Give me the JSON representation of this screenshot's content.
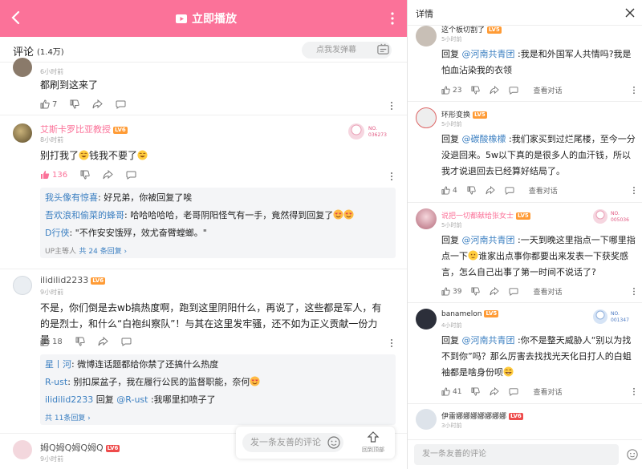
{
  "topbar": {
    "play_label": "立即播放"
  },
  "comments_header": {
    "title": "评论",
    "count": "(1.4万)",
    "danmu_placeholder": "点我发弹幕"
  },
  "left_comments": [
    {
      "time": "6小时前",
      "text": "都刷到这来了",
      "likes": "7"
    },
    {
      "user": "艾斯卡罗比亚教授",
      "level": "LV6",
      "time": "8小时前",
      "text": "别打我了",
      "text2": "钱我不要了",
      "likes": "136",
      "badge_no": "NO.\n036273",
      "replies": [
        {
          "user": "我头像有惊喜",
          "text": ": 好兄弟，你被回复了唉"
        },
        {
          "user": "吾欢浪和偷菜的蜂哥",
          "text": ": 哈哈哈哈哈，老哥阴阳怪气有一手，竟然得到回复了"
        },
        {
          "user": "D行侠",
          "text": ": \"不作安安饿殍，效尤奋臂螳螂。\""
        }
      ],
      "reply_footer_up": "UP主等人",
      "reply_footer_total": "共 24 条回复 ›"
    },
    {
      "user": "ilidilid2233",
      "level": "LV6",
      "time": "9小时前",
      "text": "不是，你们倒是去wb搞热度啊，跑到这里阴阳什么，再说了，这些都是军人，有的是烈士，和什么“白袍纠察队”！与其在这里发牢骚，还不如为正义贡献一份力量",
      "likes": "18",
      "replies": [
        {
          "user": "星丨河",
          "text": ": 微博连话题都给你禁了还搞什么热度"
        },
        {
          "user": "R-ust",
          "text": ": 别扣屎盆子，我在履行公民的监督职能，奈何"
        },
        {
          "user": "ilidilid2233",
          "mid": " 回复 ",
          "mention": "@R-ust",
          "text": " :我哪里扣喷子了"
        }
      ],
      "reply_footer_total": "共 11条回复 ›"
    },
    {
      "user": "姆Q姆Q姆Q姆Q",
      "level": "LV6",
      "time": "9小时前"
    }
  ],
  "bottom_bar": {
    "placeholder": "发一条友善的评论",
    "up_label": "回到顶部"
  },
  "detail_panel": {
    "title": "详情",
    "items": [
      {
        "user": "这个板切割了",
        "level": "LV5",
        "time": "5小时前",
        "reply_word": "回复 ",
        "mention": "@河南共青团",
        "text": " :我是和外国军人共情吗?我是怕血沾染我的衣领",
        "likes": "23",
        "view_label": "查看对话"
      },
      {
        "user": "环形变换",
        "level": "LV5",
        "time": "5小时前",
        "reply_word": "回复 ",
        "mention": "@碳酸橡檬",
        "text": " :我们家买到过烂尾楼，至今一分没退回来。5w以下真的是很多人的血汗钱，所以我才说退回去已经算好结局了。",
        "likes": "4",
        "view_label": "查看对话"
      },
      {
        "user": "说把一切都献给张女士",
        "level": "LV5",
        "time": "5小时前",
        "reply_word": "回复 ",
        "mention": "@河南共青团",
        "text": " :一天到晚这里指点一下哪里指点一下",
        "text2": "谁家出点事你都要出来发表一下获奖感言，怎么自己出事了第一时间不说话了?",
        "likes": "39",
        "view_label": "查看对话",
        "badge_no": "NO.\n005036"
      },
      {
        "user": "banamelon",
        "level": "LV5",
        "time": "4小时前",
        "reply_word": "回复 ",
        "mention": "@河南共青团",
        "text": " :你不是整天威胁人“别以为找不到你”吗？那么厉害去找找光天化日打人的白蛆袖都是啥身份呗",
        "likes": "41",
        "view_label": "查看对话",
        "badge_no": "NO.\n001347"
      },
      {
        "user": "伊雷娜娜娜娜娜娜娜",
        "level": "LV6",
        "time": "3小时前"
      }
    ],
    "input_placeholder": "发一条友善的评论"
  },
  "colors": {
    "brand_pink": "#fb7299",
    "link_blue": "#3b7fc1",
    "muted": "#999999"
  }
}
